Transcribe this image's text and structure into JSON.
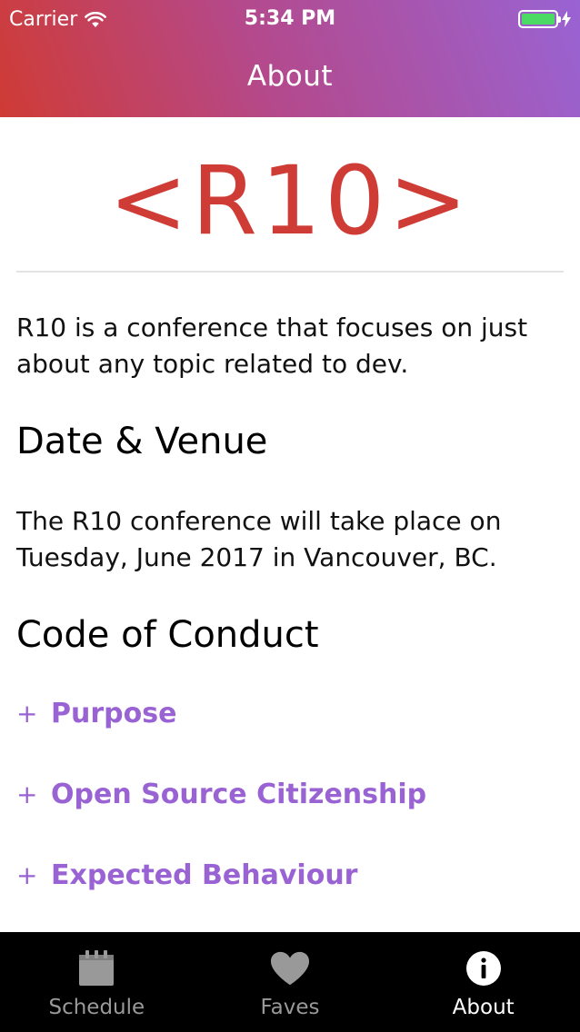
{
  "status_bar": {
    "carrier": "Carrier",
    "time": "5:34 PM"
  },
  "nav": {
    "title": "About"
  },
  "logo": {
    "text": "<R10>"
  },
  "about": {
    "intro": "R10 is a conference that focuses on just about any topic related to dev.",
    "date_heading": "Date & Venue",
    "date_text": "The R10 conference will take place on Tuesday, June 2017 in Vancouver, BC.",
    "coc_heading": "Code of Conduct",
    "coc_items": [
      {
        "symbol": "+",
        "label": "Purpose"
      },
      {
        "symbol": "+",
        "label": "Open Source Citizenship"
      },
      {
        "symbol": "+",
        "label": "Expected Behaviour"
      }
    ]
  },
  "tabs": [
    {
      "label": "Schedule",
      "icon": "calendar-icon",
      "active": false
    },
    {
      "label": "Faves",
      "icon": "heart-icon",
      "active": false
    },
    {
      "label": "About",
      "icon": "info-icon",
      "active": true
    }
  ],
  "colors": {
    "brand_red": "#cf3b35",
    "brand_purple": "#9963d3",
    "battery_green": "#4cd964",
    "tab_inactive": "#999999"
  }
}
